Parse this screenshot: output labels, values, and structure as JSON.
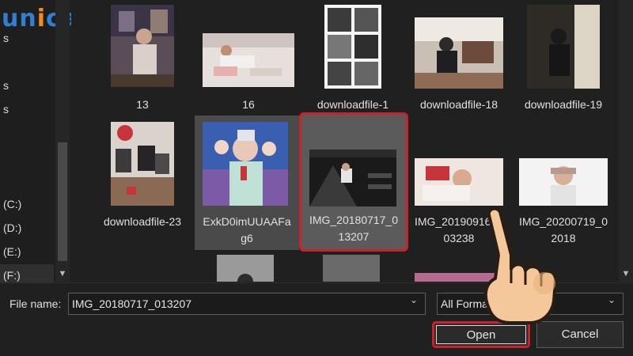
{
  "brand": {
    "logo_letters": [
      "u",
      "n",
      "i",
      "c",
      "a"
    ]
  },
  "sidebar": {
    "partial_items": [
      "s",
      "s",
      "s"
    ],
    "drives": [
      "(C:)",
      "(D:)",
      "(E:)",
      "(F:)"
    ]
  },
  "files": [
    {
      "name": "13"
    },
    {
      "name": "16"
    },
    {
      "name": "downloadfile-1"
    },
    {
      "name": "downloadfile-18"
    },
    {
      "name": "downloadfile-19"
    },
    {
      "name": "downloadfile-23"
    },
    {
      "name_line1": "ExkD0imUUAAFa",
      "name_line2": "g6"
    },
    {
      "name_line1": "IMG_20180717_0",
      "name_line2": "13207"
    },
    {
      "name_line1": "IMG_20190916_0",
      "name_line2": "03238"
    },
    {
      "name_line1": "IMG_20200719_0",
      "name_line2": "2018"
    }
  ],
  "footer": {
    "file_name_label": "File name:",
    "file_name_value": "IMG_20180717_013207",
    "format_value": "All Formats",
    "open_label": "Open",
    "cancel_label": "Cancel"
  },
  "colors": {
    "highlight": "#c8232c",
    "background": "#202020",
    "logo_blue": "#2f7fd3",
    "logo_orange": "#f08a24"
  },
  "icons": [
    "chevron-down-icon",
    "pointing-hand-icon"
  ]
}
